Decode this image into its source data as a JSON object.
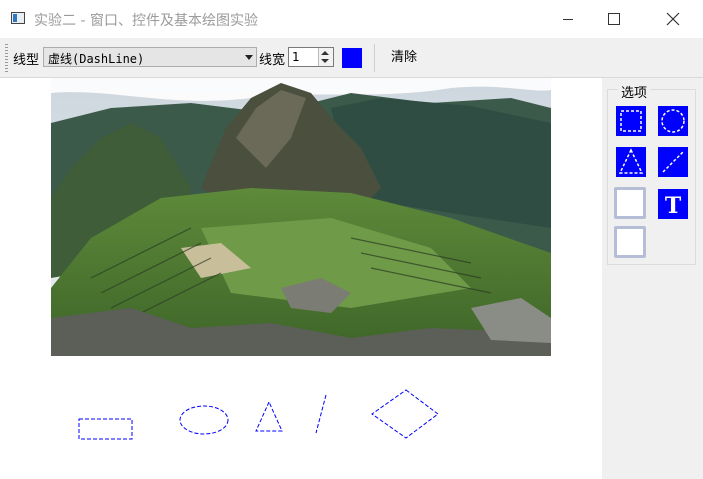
{
  "window": {
    "title": "实验二 - 窗口、控件及基本绘图实验"
  },
  "window_controls": {
    "minimize_icon": "minimize-icon",
    "maximize_icon": "maximize-icon",
    "close_icon": "close-icon"
  },
  "toolbar": {
    "line_style_label": "线型",
    "line_style_value": "虚线(DashLine)",
    "line_width_label": "线宽",
    "line_width_value": "1",
    "pen_color": "#0000ff",
    "clear_label": "清除"
  },
  "options": {
    "title": "选项",
    "tools": [
      {
        "icon": "dashed-rectangle-icon"
      },
      {
        "icon": "dashed-ellipse-icon"
      },
      {
        "icon": "dashed-triangle-icon"
      },
      {
        "icon": "dashed-line-icon"
      },
      {
        "icon": "blank-tool-icon"
      },
      {
        "icon": "text-icon",
        "glyph": "T"
      },
      {
        "icon": "blank-tool-icon"
      }
    ]
  },
  "canvas": {
    "image": "mountain-ruins-photo",
    "shape_color": "#0000ff",
    "drawn_shapes": [
      "rectangle",
      "ellipse",
      "triangle",
      "line",
      "diamond"
    ]
  }
}
